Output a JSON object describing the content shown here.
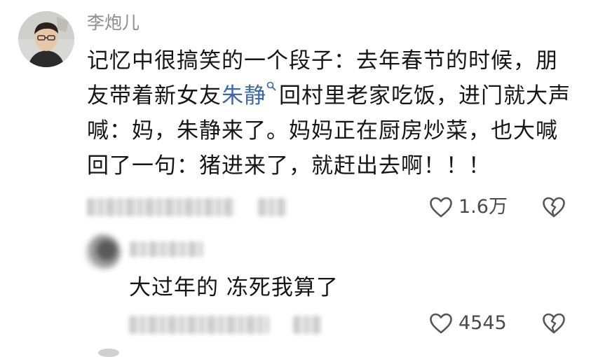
{
  "comment": {
    "username": "李炮儿",
    "text_parts": [
      "记忆中很搞笑的一个段子：去年春节的时候，朋友带着新女友",
      "朱静",
      "回村里老家吃饭，进门就大声喊：妈，朱静来了。妈妈正在厨房炒菜，也大喊回了一句：猪进来了，就赶出去啊！！！"
    ],
    "like_count": "1.6万",
    "icons": {
      "avatar": "avatar",
      "hashtag": "search-icon",
      "like": "heart-icon",
      "dislike": "broken-heart-icon"
    }
  },
  "reply": {
    "text": "大过年的 冻死我算了",
    "like_count": "4545"
  },
  "colors": {
    "link": "#3a68a8",
    "username": "#8e8e8e",
    "text": "#161616",
    "icon": "#555555"
  }
}
